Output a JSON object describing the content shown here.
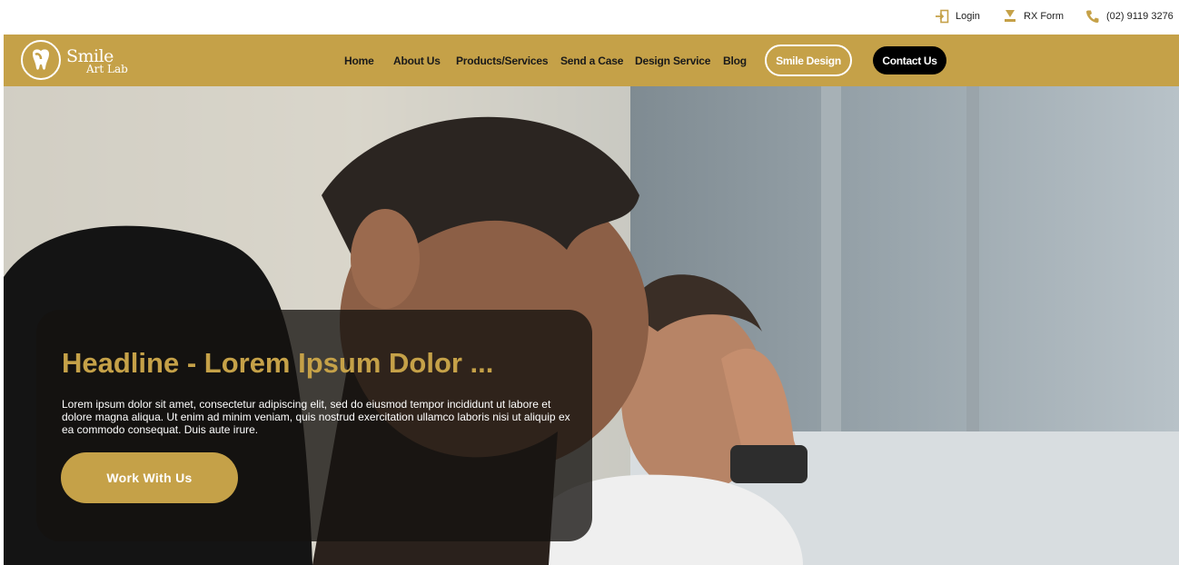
{
  "topbar": {
    "login_label": "Login",
    "rx_label": "RX Form",
    "phone_label": "(02) 9119 3276",
    "icons": [
      "login-icon",
      "download-icon",
      "phone-icon"
    ]
  },
  "brand": {
    "name_line1": "Smile",
    "name_line2": "Art Lab",
    "accent_color": "#C5A148"
  },
  "nav": {
    "items": [
      {
        "label": "Home"
      },
      {
        "label": "About Us"
      },
      {
        "label": "Products/Services"
      },
      {
        "label": "Send a Case"
      },
      {
        "label": "Design Service"
      },
      {
        "label": "Blog"
      }
    ],
    "smile_design_label": "Smile Design",
    "contact_label": "Contact Us"
  },
  "hero": {
    "headline": "Headline - Lorem Ipsum Dolor ...",
    "body": "Lorem ipsum dolor sit amet, consectetur adipiscing elit, sed do eiusmod tempor incididunt ut labore et dolore magna aliqua. Ut enim ad minim veniam, quis nostrud exercitation ullamco laboris nisi ut aliquip ex ea commodo consequat. Duis aute irure.",
    "cta_label": "Work With Us"
  }
}
